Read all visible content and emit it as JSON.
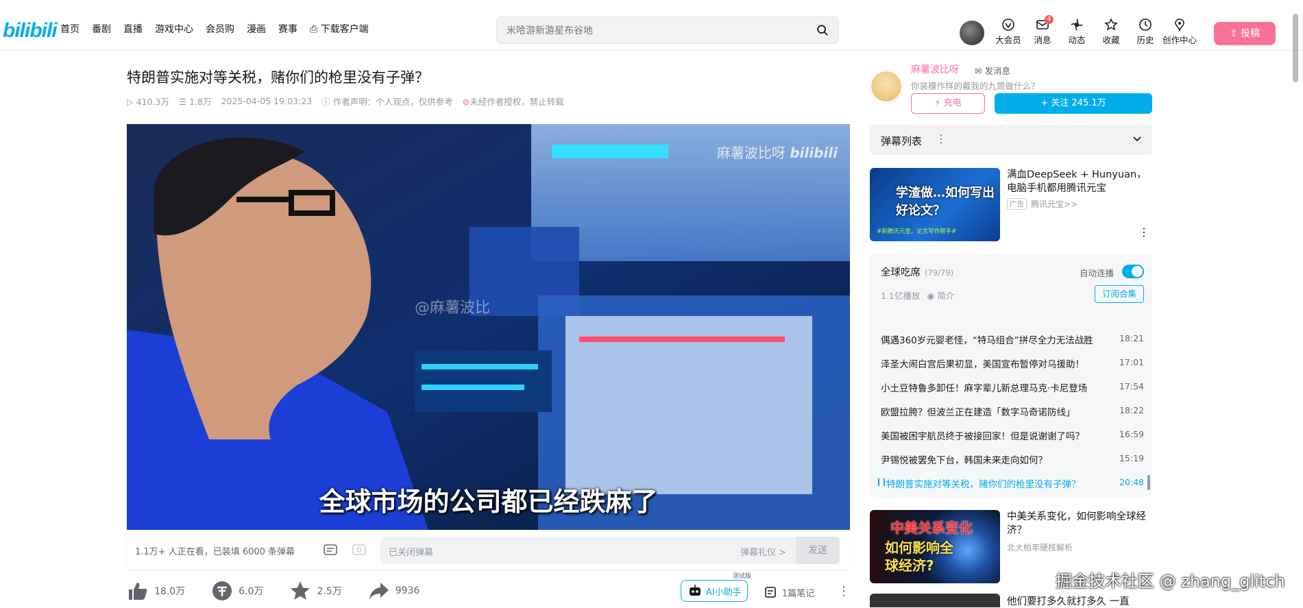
{
  "header": {
    "logo": "bilibili",
    "nav": [
      "首页",
      "番剧",
      "直播",
      "游戏中心",
      "会员购",
      "漫画",
      "赛事",
      "下载客户端"
    ],
    "search_placeholder": "米哈游新游星布谷地",
    "right_nav": [
      {
        "label": "大会员",
        "icon": "vip-icon"
      },
      {
        "label": "消息",
        "icon": "message-icon",
        "badge": "4"
      },
      {
        "label": "动态",
        "icon": "dynamic-icon"
      },
      {
        "label": "收藏",
        "icon": "favorite-icon"
      },
      {
        "label": "历史",
        "icon": "history-icon"
      },
      {
        "label": "创作中心",
        "icon": "creator-icon"
      }
    ],
    "upload_label": "投稿"
  },
  "video": {
    "title": "特朗普实施对等关税，赌你们的枪里没有子弹？",
    "views": "410.3万",
    "danmaku_count": "1.8万",
    "date": "2025-04-05 19:03:23",
    "statement": "作者声明：个人观点，仅供参考",
    "reprint": "未经作者授权，禁止转载",
    "subtitle": "全球市场的公司都已经跌麻了",
    "watermark_top": "麻薯波比呀",
    "watermark_mid": "@麻薯波比"
  },
  "danmaku_bar": {
    "viewers": "1.1万+ 人正在看，已装填 6000 条弹幕",
    "placeholder": "已关闭弹幕",
    "etiquette": "弹幕礼仪 >",
    "send": "发送"
  },
  "actions": {
    "like": "18.0万",
    "coin": "6.0万",
    "favorite": "2.5万",
    "share": "9936",
    "ai_label": "AI小助手",
    "ai_tag": "测试版",
    "notes": "1篇笔记"
  },
  "uploader": {
    "name": "麻薯波比呀",
    "message_label": "发消息",
    "sign": "你装模作样的戴我的九筒做什么？",
    "charge_label": "充电",
    "follow_label": "+ 关注 245.1万"
  },
  "danmaku_list": {
    "title": "弹幕列表"
  },
  "ad": {
    "title": "满血DeepSeek + Hunyuan，电脑手机都用腾讯元宝",
    "tag": "广告",
    "source": "腾讯元宝>>",
    "thumb_text": "学渣做…如何写出好论文？",
    "thumb_sub": "#新腾讯元宝，论文写作帮手#"
  },
  "collection": {
    "title": "全球吃席",
    "count": "(79/79)",
    "autoplay": "自动连播",
    "plays": "1.1亿播放",
    "intro": "简介",
    "subscribe": "订阅合集",
    "episodes": [
      {
        "title": "偶遇360岁元婴老怪，“特马组合”拼尽全力无法战胜",
        "duration": "18:21"
      },
      {
        "title": "泽圣大闹白宫后果初显，美国宣布暂停对乌援助！",
        "duration": "17:01"
      },
      {
        "title": "小土豆特鲁多卸任！麻字辈儿新总理马克·卡尼登场",
        "duration": "17:54"
      },
      {
        "title": "欧盟拉胯？但波兰正在建造「数字马奇诺防线」",
        "duration": "18:22"
      },
      {
        "title": "美国被困宇航员终于被接回家！但是说谢谢了吗？",
        "duration": "16:59"
      },
      {
        "title": "尹锡悦被罢免下台，韩国未来走向如何？",
        "duration": "15:19"
      },
      {
        "title": "特朗普实施对等关税，赌你们的枪里没有子弹？",
        "duration": "20:48",
        "active": true
      }
    ]
  },
  "recommend": [
    {
      "title": "中美关系变化，如何影响全球经济？",
      "author": "北大柏年硬核解析",
      "thumb_top": "中美关系变化",
      "thumb_bottom": "如何影响全球经济?"
    },
    {
      "title": "他们要打多久就打多久 一直",
      "author": ""
    }
  ],
  "site_watermark": "掘金技术社区 @ zhang_glitch"
}
